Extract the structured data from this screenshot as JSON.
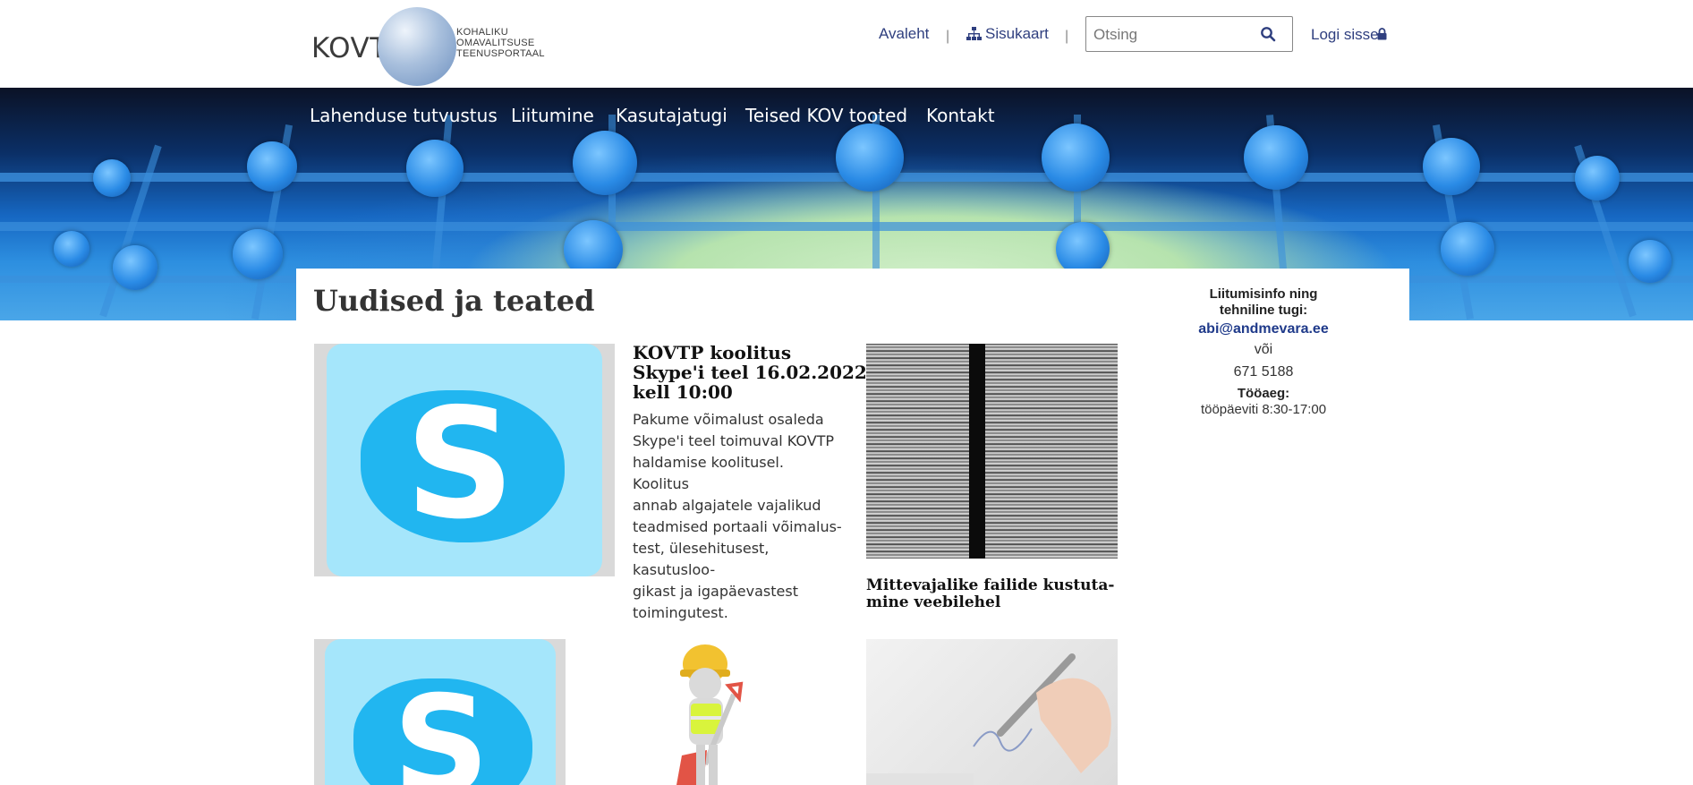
{
  "header": {
    "logo_text": "KOVTP",
    "logo_sub": [
      "KOHALIKU",
      "OMAVALITSUSE",
      "TEENUSPORTAAL"
    ],
    "links": {
      "home": "Avaleht",
      "sitemap": "Sisukaart",
      "login": "Logi sisse"
    },
    "separator": "|",
    "search": {
      "placeholder": "Otsing",
      "value": ""
    }
  },
  "nav": {
    "items": [
      {
        "label": "Lahenduse tutvustus"
      },
      {
        "label": "Liitumine"
      },
      {
        "label": "Kasutajatugi"
      },
      {
        "label": "Teised KOV tooted"
      },
      {
        "label": "Kontakt"
      }
    ]
  },
  "main": {
    "title": "Uudised ja teated",
    "news": [
      {
        "title_lines": [
          "KOVTP koolitus",
          "Skype'i teel 16.02.2022",
          "kell 10:00"
        ],
        "body_lines": [
          "Pakume võimalust osaleda",
          "Skype'i teel toimuval KOVTP",
          "haldamise koolitusel. Koolitus",
          "annab algajatele vajalikud",
          "teadmised portaali võimalus-",
          "test, ülesehitusest, kasutusloo-",
          "gikast ja igapäevastest",
          "toimingutest."
        ]
      },
      {
        "title_lines": [
          "Mittevajalike failide kustuta-",
          "mine veebilehel"
        ]
      }
    ]
  },
  "sidebar": {
    "heading_lines": [
      "Liitumisinfo ning",
      "tehniline tugi:"
    ],
    "email": "abi@andmevara.ee",
    "or": "või",
    "phone": "671 5188",
    "hours_label": "Tööaeg:",
    "hours": "tööpäeviti 8:30-17:00"
  },
  "colors": {
    "link": "#2f3f7f",
    "sidebar_link": "#1f3a8a",
    "skype": "#21b6f0"
  }
}
